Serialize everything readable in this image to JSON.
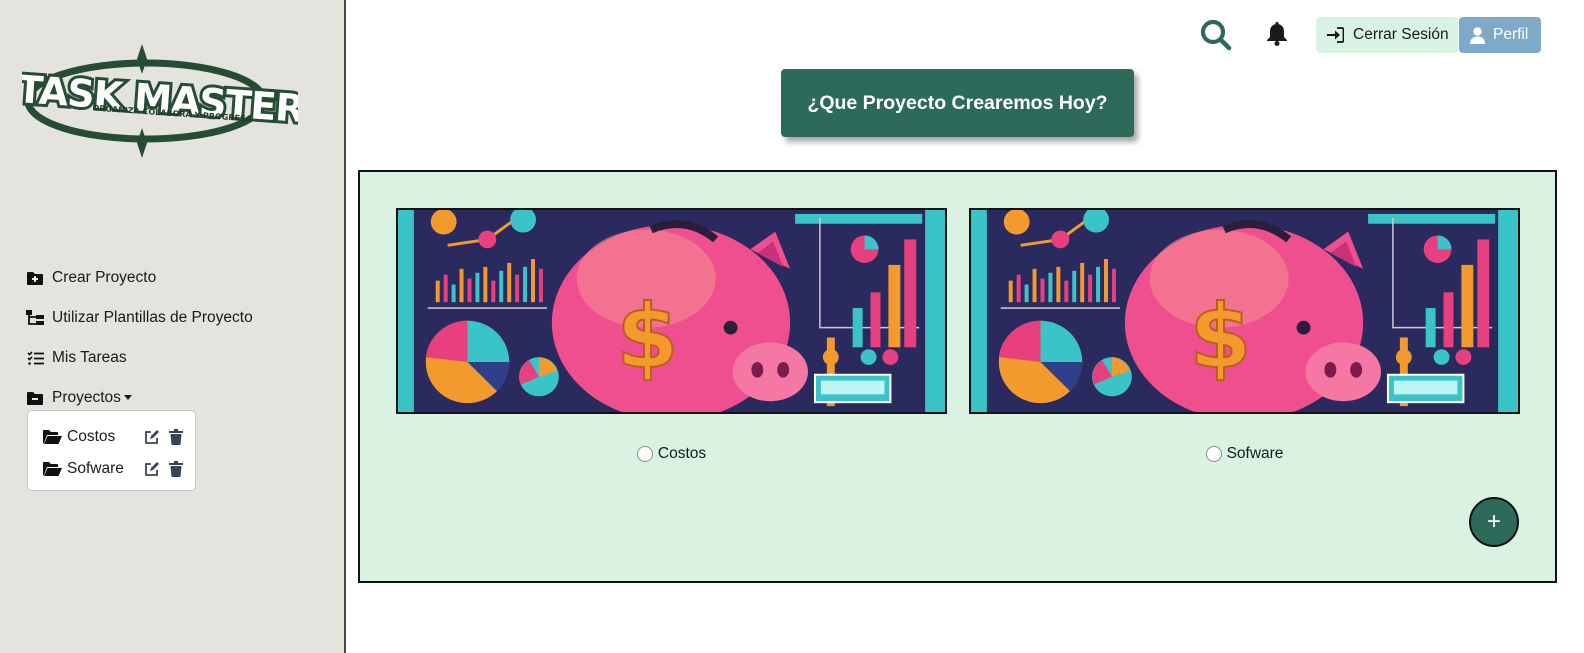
{
  "logo": {
    "title": "TASK MASTER",
    "tagline": "ORGANIZA COLABORA Y PROGRESA"
  },
  "sidebar": {
    "items": [
      {
        "label": "Crear Proyecto",
        "icon": "folder-plus-icon"
      },
      {
        "label": "Utilizar Plantillas de Proyecto",
        "icon": "sitemap-icon"
      },
      {
        "label": "Mis Tareas",
        "icon": "list-check-icon"
      },
      {
        "label": "Proyectos",
        "icon": "folder-minus-icon"
      }
    ],
    "projects": [
      {
        "name": "Costos"
      },
      {
        "name": "Sofware"
      }
    ]
  },
  "topbar": {
    "logout_label": "Cerrar Sesión",
    "profile_label": "Perfil"
  },
  "hero": {
    "title": "¿Que Proyecto Crearemos Hoy?"
  },
  "main": {
    "cards": [
      {
        "name": "Costos"
      },
      {
        "name": "Sofware"
      }
    ],
    "add_label": "+"
  },
  "colors": {
    "accent": "#2e6a5a",
    "panel_bg": "#d9f2e2",
    "sidebar_bg": "#e4e3de",
    "profile_bg": "#7fa9c8"
  }
}
